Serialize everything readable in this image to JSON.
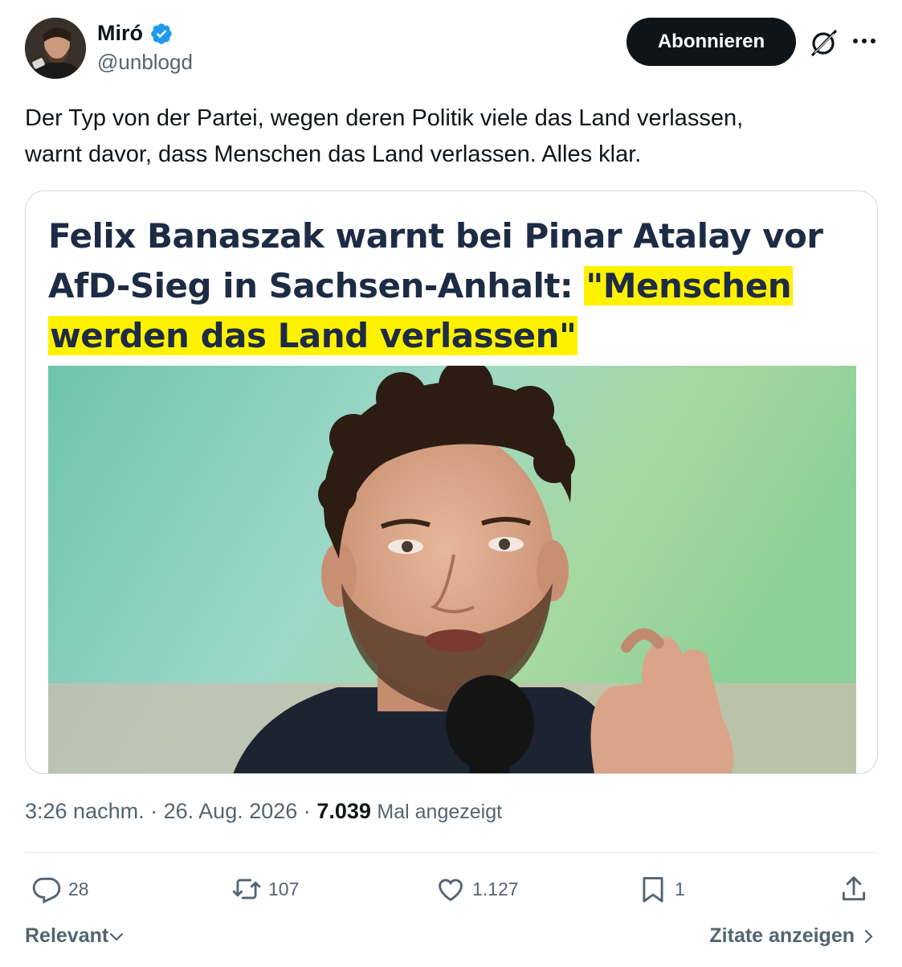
{
  "author": {
    "display_name": "Miró",
    "handle": "@unblogd",
    "verified": true,
    "verified_color": "#1d9bf0"
  },
  "header": {
    "follow_label": "Abonnieren",
    "grok_icon": "grok-icon",
    "more_icon": "more-icon"
  },
  "tweet": {
    "text_line1": "Der Typ von der Partei, wegen deren Politik viele das Land verlassen,",
    "text_line2": "warnt davor, dass Menschen das Land verlassen. Alles klar."
  },
  "card": {
    "headline_plain": "Felix Banaszak warnt bei Pinar Atalay vor AfD-Sieg in Sachsen-Anhalt: ",
    "headline_highlight_1": "\"Menschen",
    "headline_highlight_2": "werden das Land verlassen\"",
    "highlight_color": "#fff200",
    "headline_color": "#1d2b45"
  },
  "meta": {
    "time": "3:26 nachm.",
    "separator": "·",
    "date": "26. Aug. 2026",
    "views_count": "7.039",
    "views_label": "Mal angezeigt"
  },
  "actions": {
    "replies": "28",
    "reposts": "107",
    "likes": "1.127",
    "bookmarks": "1"
  },
  "footer": {
    "sort_label": "Relevant",
    "quotes_label": "Zitate anzeigen"
  },
  "colors": {
    "text_primary": "#0f1419",
    "text_secondary": "#536471",
    "button_bg": "#0f1419",
    "border": "#cfd9de"
  }
}
